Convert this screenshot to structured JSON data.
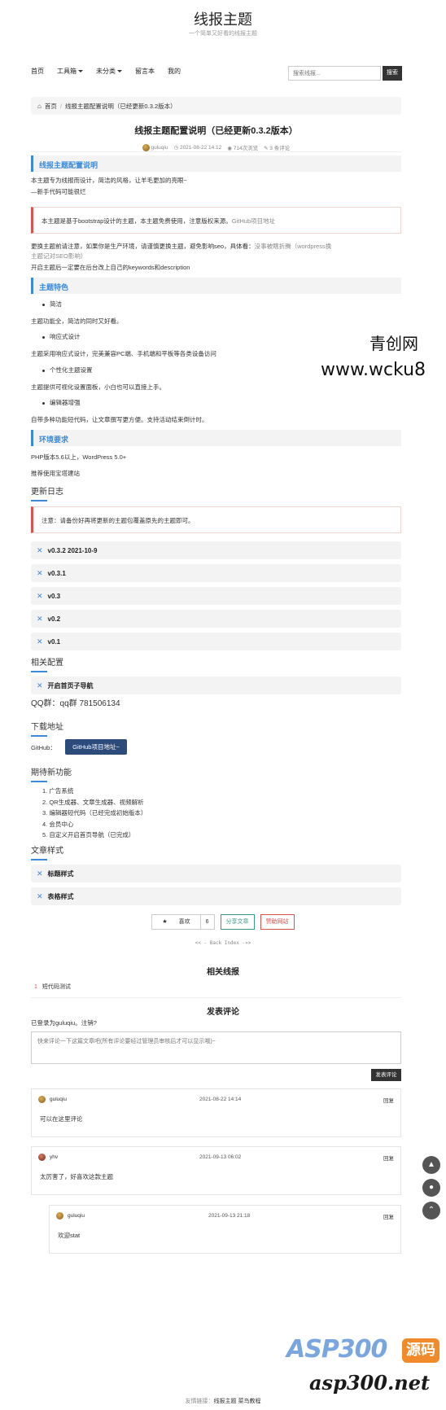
{
  "site": {
    "title": "线报主题",
    "subtitle": "一个简单又好看的线报主题"
  },
  "nav": {
    "items": [
      "首页",
      "工具箱",
      "未分类",
      "留言本",
      "我的"
    ],
    "search_placeholder": "搜索线报...",
    "search_button": "搜索"
  },
  "breadcrumb": {
    "home": "首页",
    "current": "线报主题配置说明（已经更新0.3.2版本）"
  },
  "post": {
    "title": "线报主题配置说明（已经更新0.3.2版本）",
    "author": "guluqiu",
    "date": "2021-08-22 14:12",
    "views": "714次浏览",
    "comments": "3 条评论"
  },
  "content": {
    "h_config": "线报主题配置说明",
    "intro1": "本主题专为线报而设计，简洁的风格，让羊毛更加的亮眼~",
    "intro2": "—新手代码可能很烂",
    "notice1_text": "本主题是基于bootstrap设计的主题，本主题免费使用，注意版权来源。",
    "notice1_link": "GitHub项目地址",
    "p_warn1": "更换主题前请注意，如果你是生产环境，请谨慎更换主题，避免影响seo，具体看：",
    "p_warn1_link": "没事被瞎折腾（wordpress换",
    "p_warn1_link2": "主题记对SEO影响）",
    "p_warn2": "开启主题后一定要在后台改上自己的keywords和description",
    "h_features": "主题特色",
    "f1": "简洁",
    "f1_desc": "主题功能全，简洁的同时又好看。",
    "f2": "响应式设计",
    "f2_desc": "主题采用响应式设计，完美兼容PC端、手机端和平板等各类设备访问",
    "f3": "个性化主题设置",
    "f3_desc": "主题提供可视化设置面板，小白也可以直接上手。",
    "f4": "编辑器增强",
    "f4_desc": "自带多种功能短代码，让文章撰写更方便。支持活动结束倒计时。",
    "h_env": "环境要求",
    "env1": "PHP版本5.6以上，WordPress 5.0+",
    "env2": "推荐使用宝塔建站",
    "h_changelog": "更新日志",
    "notice2": "注意：请备份好再将更新的主题包覆盖原先的主题即可。",
    "versions": [
      "v0.3.2 2021-10-9",
      "v0.3.1",
      "v0.3",
      "v0.2",
      "v0.1"
    ],
    "h_related_cfg": "相关配置",
    "acc_nav": "开启首页子导航",
    "qq": "QQ群：qq群 781506134",
    "h_download": "下载地址",
    "github_label": "GitHub：",
    "github_btn": "GitHub项目地址~",
    "h_expect": "期待新功能",
    "expect": [
      "1. 广告系统",
      "2. QR生成器、文章生成器、视频解析",
      "3. 编辑器短代码（已经完成初始版本）",
      "4. 会员中心",
      "5. 自定义开启首页导航（已完成）"
    ],
    "h_style": "文章样式",
    "style_items": [
      "标题样式",
      "表格样式"
    ]
  },
  "actions": {
    "like": "喜欢",
    "like_count": "6",
    "share": "分享文章",
    "sponsor": "赞助网站"
  },
  "back_index": "<< - Back Index -»>",
  "related": {
    "title": "相关线报",
    "items": [
      {
        "n": "1",
        "text": "短代码测试"
      }
    ]
  },
  "comment_form": {
    "title": "发表评论",
    "login_line": "已登录为guluqiu。注销?",
    "placeholder": "快来评论一下这篇文章吧(所有评论要经过管理员审核后才可以显示哦)~",
    "submit": "发表评论"
  },
  "comments": [
    {
      "name": "guluqiu",
      "time": "2021-08-22 14:14",
      "reply": "回复",
      "body": "可以在这里评论"
    },
    {
      "name": "yhv",
      "time": "2021-09-13 06:02",
      "reply": "回复",
      "body": "太厉害了，好喜欢这款主题"
    },
    {
      "name": "guluqiu",
      "time": "2021-09-13 21:18",
      "reply": "回复",
      "body": "欢迎stat"
    }
  ],
  "footer": {
    "label": "友情链接：",
    "links": "线报主题 菜鸟教程"
  },
  "watermarks": {
    "wm1_line1": "青创网",
    "wm1_line2": "www.wcku8",
    "asp_logo": "ASP300",
    "asp_tag": "源码",
    "asp_url": "asp300.net"
  },
  "colors": {
    "accent": "#3b8ad9",
    "danger": "#d9534f",
    "dark": "#333333",
    "github_btn": "#2c4a7a"
  }
}
